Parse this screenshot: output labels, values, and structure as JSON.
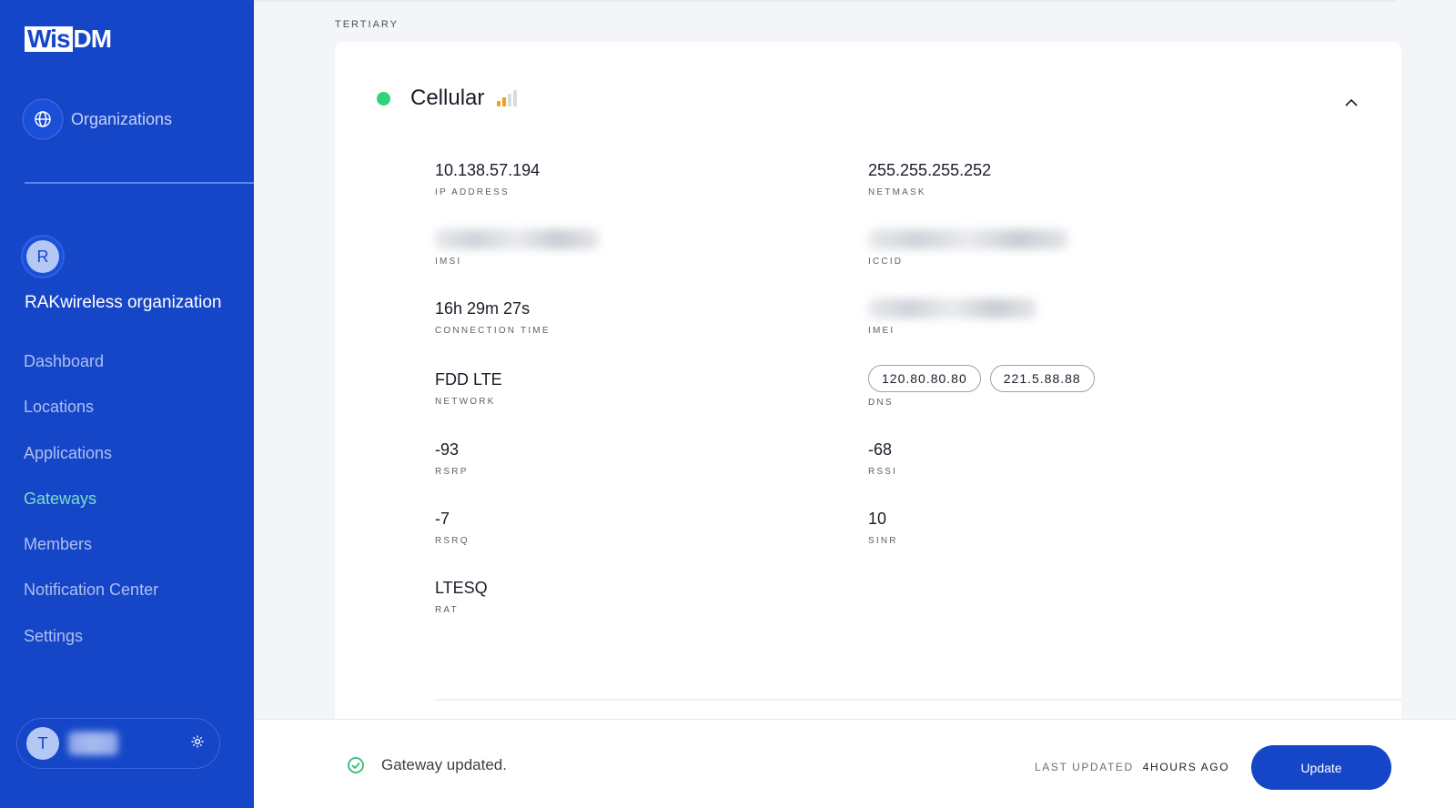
{
  "sidebar": {
    "logo_left": "Wis",
    "logo_right": "DM",
    "organizations_label": "Organizations",
    "org_initial": "R",
    "org_name": "RAKwireless organization",
    "nav": [
      {
        "label": "Dashboard"
      },
      {
        "label": "Locations"
      },
      {
        "label": "Applications"
      },
      {
        "label": "Gateways",
        "active": true
      },
      {
        "label": "Members"
      },
      {
        "label": "Notification Center"
      },
      {
        "label": "Settings"
      }
    ],
    "user_initial": "T"
  },
  "main": {
    "section_label": "TERTIARY",
    "card": {
      "title": "Cellular",
      "status_color": "#2ed37a",
      "signal_bars_active": 2,
      "fields": {
        "ip_address": {
          "value": "10.138.57.194",
          "key": "IP ADDRESS"
        },
        "netmask": {
          "value": "255.255.255.252",
          "key": "NETMASK"
        },
        "imsi": {
          "key": "IMSI"
        },
        "iccid": {
          "key": "ICCID"
        },
        "connection_time": {
          "value": "16h 29m 27s",
          "key": "CONNECTION TIME"
        },
        "imei": {
          "key": "IMEI"
        },
        "network": {
          "value": "FDD LTE",
          "key": "NETWORK"
        },
        "dns": {
          "values": [
            "120.80.80.80",
            "221.5.88.88"
          ],
          "key": "DNS"
        },
        "rsrp": {
          "value": "-93",
          "key": "RSRP"
        },
        "rssi": {
          "value": "-68",
          "key": "RSSI"
        },
        "rsrq": {
          "value": "-7",
          "key": "RSRQ"
        },
        "sinr": {
          "value": "10",
          "key": "SINR"
        },
        "rat": {
          "value": "LTESQ",
          "key": "RAT"
        }
      }
    }
  },
  "footer": {
    "status_message": "Gateway updated.",
    "last_updated_label": "LAST UPDATED",
    "last_updated_value": "4HOURS AGO",
    "update_button": "Update"
  },
  "colors": {
    "sidebar_bg": "#1646c8",
    "active_nav": "#7ce0c8",
    "success": "#2ed37a",
    "signal_active": "#f0a020"
  }
}
